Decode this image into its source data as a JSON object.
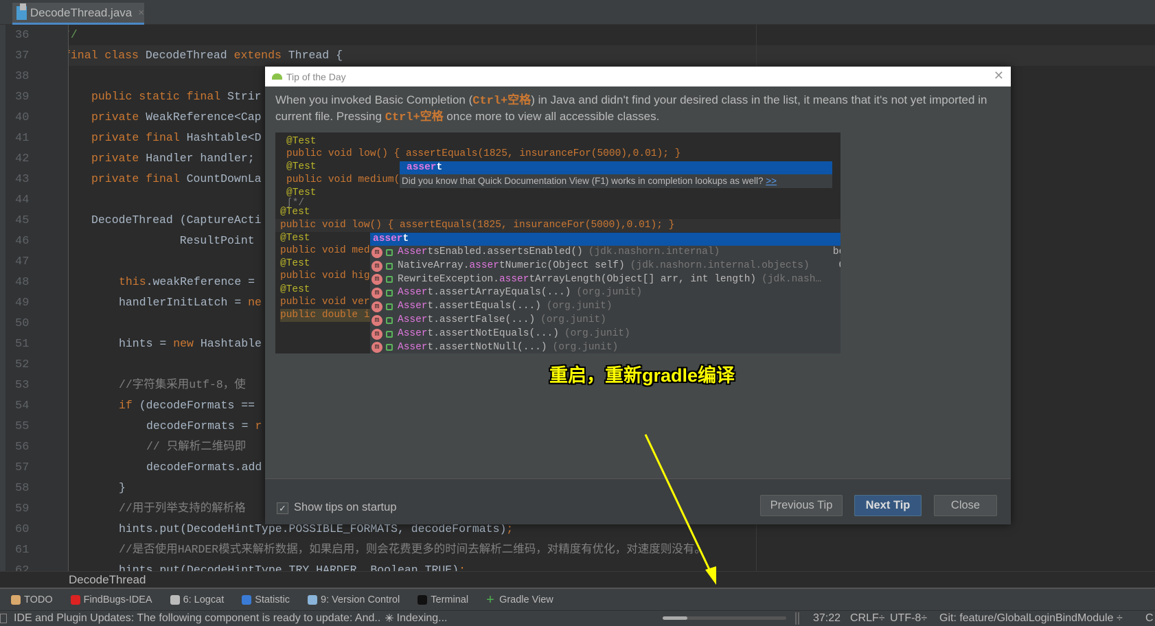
{
  "tab": {
    "file_name": "DecodeThread.java",
    "close": "×"
  },
  "editor": {
    "line_numbers": [
      "36",
      "37",
      "38",
      "39",
      "40",
      "41",
      "42",
      "43",
      "44",
      "45",
      "46",
      "47",
      "48",
      "49",
      "50",
      "51",
      "52",
      "53",
      "54",
      "55",
      "56",
      "57",
      "58",
      "59",
      "60",
      "61",
      "62"
    ],
    "lines": [
      [
        [
          0,
          "*/",
          "cmg"
        ]
      ],
      [
        [
          0,
          "final class ",
          "kw"
        ],
        [
          0,
          "DecodeThread ",
          ""
        ],
        [
          0,
          "extends ",
          "kw"
        ],
        [
          0,
          "Thread {",
          ""
        ]
      ],
      [],
      [
        [
          1,
          "public static final ",
          "kw"
        ],
        [
          1,
          "Strir",
          ""
        ]
      ],
      [
        [
          1,
          "private ",
          "kw"
        ],
        [
          1,
          "WeakReference<Cap",
          ""
        ]
      ],
      [
        [
          1,
          "private final ",
          "kw"
        ],
        [
          1,
          "Hashtable<D",
          ""
        ]
      ],
      [
        [
          1,
          "private ",
          "kw"
        ],
        [
          1,
          "Handler handler;",
          ""
        ]
      ],
      [
        [
          1,
          "private final ",
          "kw"
        ],
        [
          1,
          "CountDownLa",
          ""
        ]
      ],
      [],
      [
        [
          1,
          "DecodeThread (CaptureActi",
          ""
        ]
      ],
      [
        [
          1,
          "             ResultPoint",
          ""
        ]
      ],
      [],
      [
        [
          2,
          "this",
          "kw"
        ],
        [
          2,
          ".weakReference = ",
          ""
        ]
      ],
      [
        [
          2,
          "handlerInitLatch = ",
          ""
        ],
        [
          2,
          "ne",
          "kw"
        ]
      ],
      [],
      [
        [
          2,
          "hints = ",
          ""
        ],
        [
          2,
          "new ",
          "kw"
        ],
        [
          2,
          "Hashtable",
          ""
        ]
      ],
      [],
      [
        [
          2,
          "//字符集采用utf-8，使",
          "cm"
        ]
      ],
      [
        [
          2,
          "if ",
          "kw"
        ],
        [
          2,
          "(decodeFormats == ",
          ""
        ]
      ],
      [
        [
          3,
          "decodeFormats = ",
          ""
        ],
        [
          3,
          "r",
          "kw"
        ]
      ],
      [
        [
          3,
          "// 只解析二维码即",
          "cm"
        ]
      ],
      [
        [
          3,
          "decodeFormats.add",
          ""
        ]
      ],
      [
        [
          2,
          "}",
          ""
        ]
      ],
      [
        [
          2,
          "//用于列举支持的解析格",
          "cm"
        ]
      ],
      [
        [
          2,
          "hints.put(DecodeHintType.POSSIBLE_FORMATS, decodeFormats)",
          ""
        ],
        [
          2,
          ";",
          "kw"
        ]
      ],
      [
        [
          2,
          "//是否使用HARDER模式来解析数据，如果启用，则会花费更多的时间去解析二维码，对精度有优化，对速度则没有。",
          "cm"
        ]
      ],
      [
        [
          2,
          "hints.put(DecodeHintType.TRY_HARDER, Boolean.TRUE)",
          ""
        ],
        [
          2,
          ";",
          "kw"
        ]
      ]
    ]
  },
  "breadcrumb": "DecodeThread",
  "tool_windows": [
    {
      "label": "TODO",
      "icon": "todo-icon",
      "color": "#d9a86c"
    },
    {
      "label": "FindBugs-IDEA",
      "icon": "bug-icon",
      "color": "#d22"
    },
    {
      "label": "6: Logcat",
      "icon": "logcat-icon",
      "color": "#bbb"
    },
    {
      "label": "Statistic",
      "icon": "statistic-icon",
      "color": "#3a7bd5"
    },
    {
      "label": "9: Version Control",
      "icon": "version-control-icon",
      "color": "#8ab4d9"
    },
    {
      "label": "Terminal",
      "icon": "terminal-icon",
      "color": "#111"
    },
    {
      "label": "Gradle View",
      "icon": "plus-icon",
      "color": "#4caf50"
    }
  ],
  "status": {
    "message": "IDE and Plugin Updates: The following component is ready to update: And..",
    "indexing": "Indexing...",
    "position": "37:22",
    "line_sep": "CRLF÷",
    "encoding": "UTF-8÷",
    "git": "Git: feature/GlobalLoginBindModule ÷",
    "extra": "C"
  },
  "dialog": {
    "title": "Tip of the Day",
    "tip_part1": "When you invoked Basic Completion (",
    "shortcut": "Ctrl+空格",
    "tip_part2": ") in Java and didn't find your desired class in the list, it means that it's not yet imported in current file. Pressing ",
    "tip_part3": " once more to view all accessible classes.",
    "example": {
      "top_lines": [
        "@Test",
        "public void low() { assertEquals(1825, insuranceFor(5000),0.01); }",
        "@Test",
        "public void medium(",
        "@Test",
        "ʃ*/"
      ],
      "popup1_selected": "assert",
      "popup1_doc": "Did you know that Quick Documentation View (F1) works in completion lookups as well?",
      "popup1_more": ">>",
      "bottom_lines": [
        "@Test",
        "public void low() { assertEquals(1825, insuranceFor(5000),0.01); }",
        "@Test",
        "public void med",
        "@Test",
        "public void hig",
        "@Test",
        "public void ver",
        "public double i"
      ],
      "popup2_selected": "assert",
      "items": [
        {
          "name": "AssertsEnabled.assertsEnabled()",
          "pkg": "(jdk.nashorn.internal)",
          "type": "boo"
        },
        {
          "name": "NativeArray.assertNumeric(Object self)",
          "pkg": "(jdk.nashorn.internal.objects)",
          "type": "Ob"
        },
        {
          "name": "RewriteException.assertArrayLength(Object[] arr, int length)",
          "pkg": "(jdk.nash…",
          "type": ""
        },
        {
          "name": "Assert.assertArrayEquals(...)",
          "pkg": "(org.junit)",
          "type": ""
        },
        {
          "name": "Assert.assertEquals(...)",
          "pkg": "(org.junit)",
          "type": ""
        },
        {
          "name": "Assert.assertFalse(...)",
          "pkg": "(org.junit)",
          "type": ""
        },
        {
          "name": "Assert.assertNotEquals(...)",
          "pkg": "(org.junit)",
          "type": ""
        },
        {
          "name": "Assert.assertNotNull(...)",
          "pkg": "(org.junit)",
          "type": ""
        }
      ]
    },
    "show_tips_label": "Show tips on startup",
    "show_tips_checked": true,
    "buttons": {
      "previous": "Previous Tip",
      "next": "Next Tip",
      "close": "Close"
    }
  },
  "annotation": "重启，重新gradle编译",
  "annotation_color": "#ffff00"
}
